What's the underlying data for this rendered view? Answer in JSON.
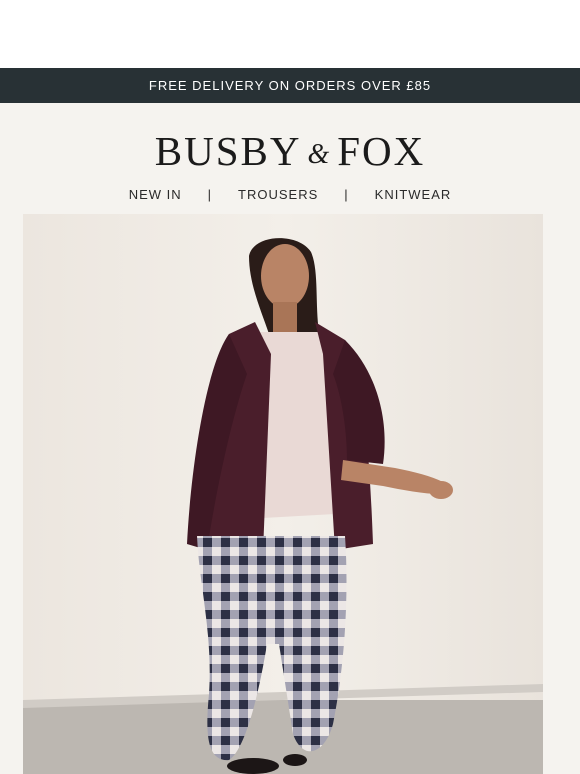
{
  "promo": {
    "text": "FREE DELIVERY ON ORDERS OVER £85"
  },
  "brand": {
    "name_left": "BUSBY",
    "ampersand": "&",
    "name_right": "FOX"
  },
  "nav": {
    "items": [
      {
        "label": "NEW IN"
      },
      {
        "label": "TROUSERS"
      },
      {
        "label": "KNITWEAR"
      }
    ],
    "separator": "|"
  },
  "hero": {
    "image_subject": "model-in-plum-mohair-cardigan-and-gingham-trousers"
  },
  "colors": {
    "promo_bg": "#283135",
    "page_bg": "#f5f3ef",
    "cardigan": "#4a1e2b",
    "gingham": "#2d3045"
  }
}
